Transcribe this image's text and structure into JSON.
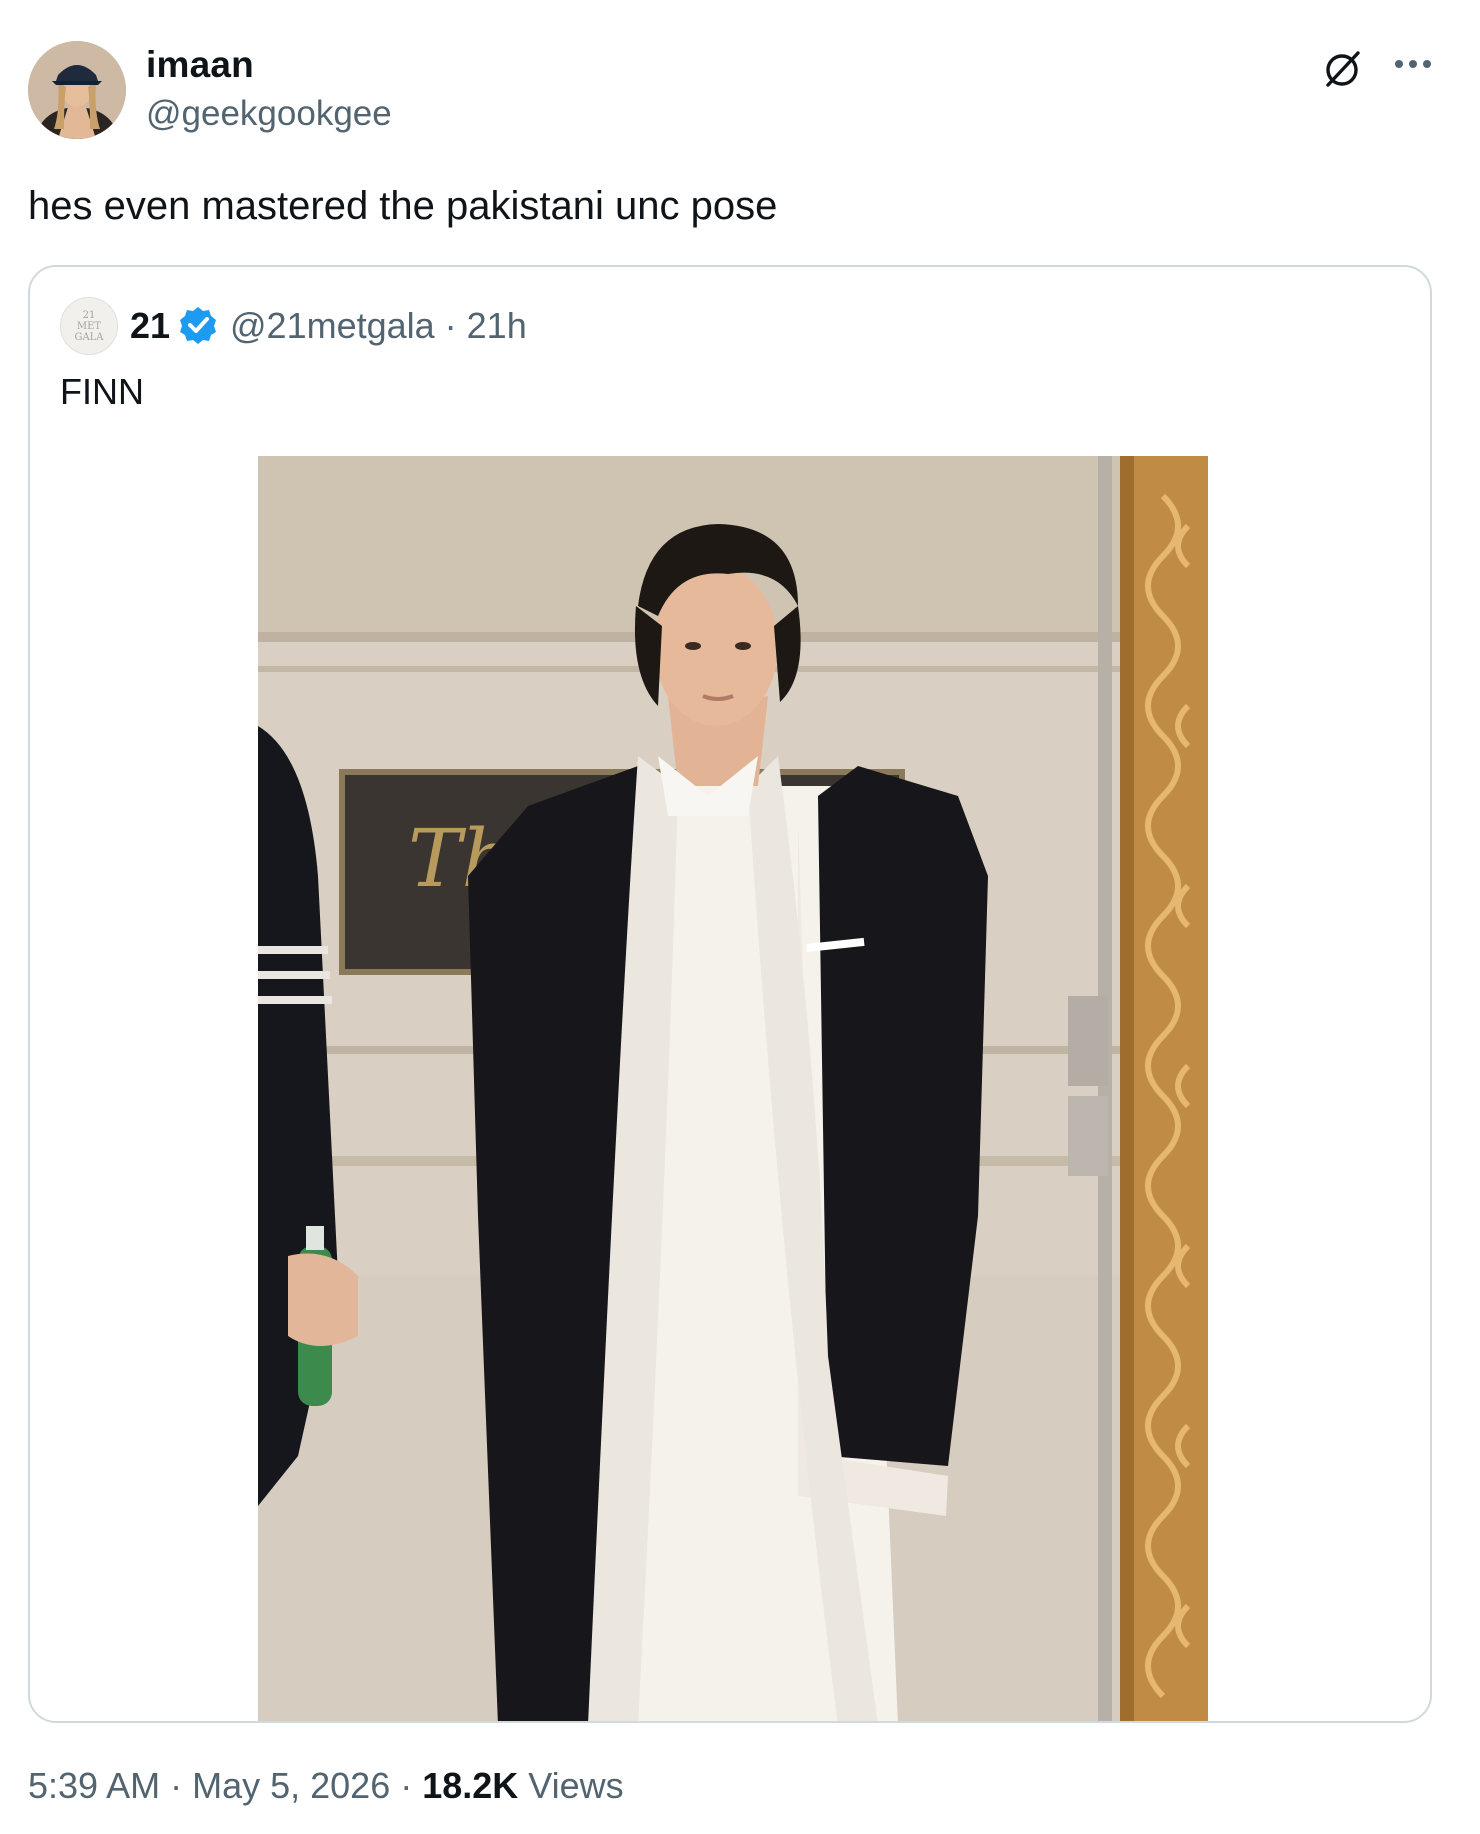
{
  "author": {
    "display_name": "imaan",
    "handle": "@geekgookgee",
    "avatar": "user-avatar"
  },
  "tweet": {
    "text": "hes even mastered the pakistani unc pose"
  },
  "actions": {
    "grok_icon": "grok-slash-icon",
    "more_icon": "more-options-icon"
  },
  "quoted": {
    "avatar_lines": [
      "21",
      "MET",
      "GALA"
    ],
    "name": "21",
    "verified_icon": "verified-badge-icon",
    "handle_time": "@21metgala · 21h",
    "text": "FINN",
    "image": "photo-man-in-black-blazer-and-white-kurta"
  },
  "footer": {
    "time": "5:39 AM",
    "sep1": " · ",
    "date": "May 5, 2026",
    "sep2": " · ",
    "views_count": "18.2K",
    "views_label": " Views"
  },
  "colors": {
    "text": "#0f1419",
    "secondary": "#536471",
    "border": "#cfd9de",
    "verified": "#1d9bf0"
  }
}
